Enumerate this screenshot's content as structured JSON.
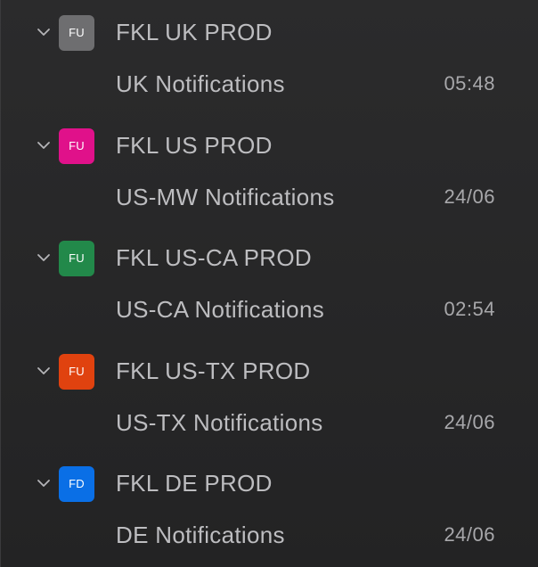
{
  "groups": [
    {
      "avatar_text": "FU",
      "avatar_color": "#6e6e70",
      "title": "FKL UK PROD",
      "expanded": true,
      "channel": {
        "name": "UK Notifications",
        "time": "05:48"
      }
    },
    {
      "avatar_text": "FU",
      "avatar_color": "#e0118a",
      "title": "FKL US PROD",
      "expanded": true,
      "channel": {
        "name": "US-MW Notifications",
        "time": "24/06"
      }
    },
    {
      "avatar_text": "FU",
      "avatar_color": "#22894a",
      "title": "FKL US-CA PROD",
      "expanded": true,
      "channel": {
        "name": "US-CA Notifications",
        "time": "02:54"
      }
    },
    {
      "avatar_text": "FU",
      "avatar_color": "#e0420f",
      "title": "FKL US-TX PROD",
      "expanded": true,
      "channel": {
        "name": "US-TX Notifications",
        "time": "24/06"
      }
    },
    {
      "avatar_text": "FD",
      "avatar_color": "#0a6fe6",
      "title": "FKL DE PROD",
      "expanded": true,
      "channel": {
        "name": "DE Notifications",
        "time": "24/06"
      }
    }
  ],
  "icons": {
    "chevron": "chevron-down-icon"
  },
  "colors": {
    "text": "#bdbdc0",
    "time": "#a8a8ab",
    "background": "#272728"
  }
}
